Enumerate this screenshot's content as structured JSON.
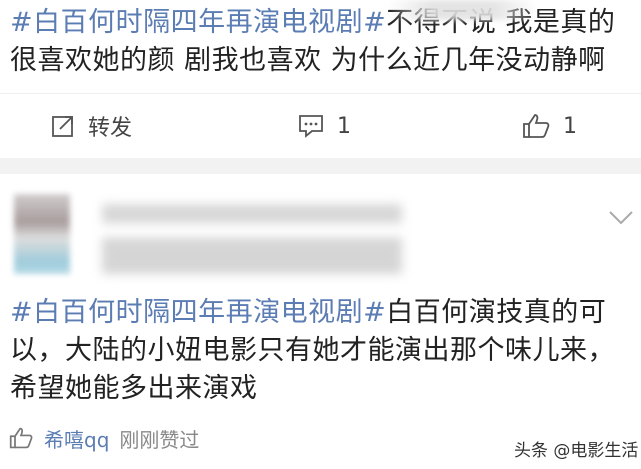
{
  "post": {
    "hashtag": "#白百何时隔四年再演电视剧#",
    "body": "不得不说 我是真的很喜欢她的颜 剧我也喜欢 为什么近几年没动静啊",
    "actions": {
      "repost_label": "转发",
      "comment_count": "1",
      "like_count": "1"
    }
  },
  "comment": {
    "hashtag": "#白百何时隔四年再演电视剧#",
    "body": "白百何演技真的可以，大陆的小妞电影只有她才能演出那个味儿来，希望她能多出来演戏",
    "liker": "希嘻qq",
    "liked_text": "刚刚赞过"
  },
  "watermark": "头条 @电影生活",
  "colors": {
    "hashtag": "#5b7db3",
    "text": "#222222",
    "band": "#f2f2f2"
  },
  "icons": [
    "repost-icon",
    "comment-icon",
    "like-icon",
    "chevron-down-icon",
    "small-like-icon"
  ]
}
